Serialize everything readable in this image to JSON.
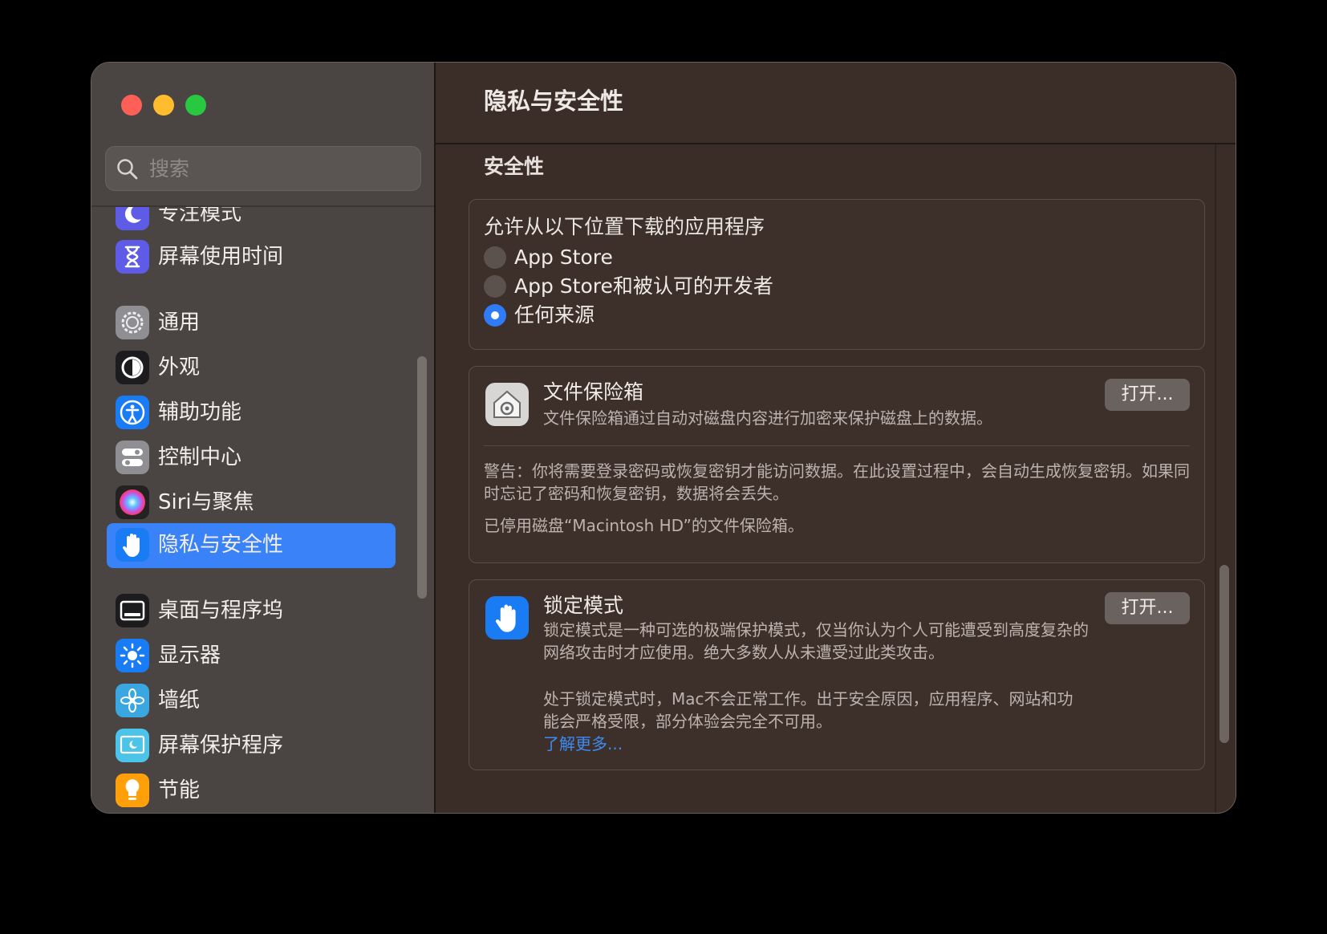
{
  "window": {
    "controls": [
      "close",
      "minimize",
      "zoom"
    ]
  },
  "sidebar": {
    "search_placeholder": "搜索",
    "items": [
      {
        "label": "专注模式",
        "icon": "moon-icon",
        "color": "#5e5ce6"
      },
      {
        "label": "屏幕使用时间",
        "icon": "hourglass-icon",
        "color": "#5e5ce6"
      },
      {
        "label": "通用",
        "icon": "gear-icon",
        "color": "#8e8e93"
      },
      {
        "label": "外观",
        "icon": "appearance-icon",
        "color": "#1c1c1e"
      },
      {
        "label": "辅助功能",
        "icon": "accessibility-icon",
        "color": "#1a7cf5"
      },
      {
        "label": "控制中心",
        "icon": "control-center-icon",
        "color": "#8e8e93"
      },
      {
        "label": "Siri与聚焦",
        "icon": "siri-icon",
        "color": "#222222"
      },
      {
        "label": "隐私与安全性",
        "icon": "hand-icon",
        "color": "#1a7cf5",
        "selected": true
      },
      {
        "label": "桌面与程序坞",
        "icon": "dock-icon",
        "color": "#1c1c1e"
      },
      {
        "label": "显示器",
        "icon": "sun-icon",
        "color": "#1a7cf5"
      },
      {
        "label": "墙纸",
        "icon": "flower-icon",
        "color": "#3aa7e0"
      },
      {
        "label": "屏幕保护程序",
        "icon": "screensaver-icon",
        "color": "#4cc3e8"
      },
      {
        "label": "节能",
        "icon": "lightbulb-icon",
        "color": "#ff9f0a"
      }
    ]
  },
  "main": {
    "title": "隐私与安全性",
    "section_title": "安全性",
    "allow": {
      "label": "允许从以下位置下载的应用程序",
      "options": [
        "App Store",
        "App Store和被认可的开发者",
        "任何来源"
      ],
      "selected": "任何来源"
    },
    "filevault": {
      "title": "文件保险箱",
      "description": "文件保险箱通过自动对磁盘内容进行加密来保护磁盘上的数据。",
      "button": "打开...",
      "warning": "警告：你将需要登录密码或恢复密钥才能访问数据。在此设置过程中，会自动生成恢复密钥。如果同时忘记了密码和恢复密钥，数据将会丢失。",
      "status": "已停用磁盘“Macintosh HD”的文件保险箱。"
    },
    "lockdown": {
      "title": "锁定模式",
      "description": "锁定模式是一种可选的极端保护模式，仅当你认为个人可能遭受到高度复杂的网络攻击时才应使用。绝大多数人从未遭受过此类攻击。",
      "description2": "处于锁定模式时，Mac不会正常工作。出于安全原因，应用程序、网站和功能会严格受限，部分体验会完全不可用。",
      "link": "了解更多...",
      "button": "打开..."
    }
  },
  "colors": {
    "accent": "#3a82f7",
    "link": "#3d8bf5"
  }
}
